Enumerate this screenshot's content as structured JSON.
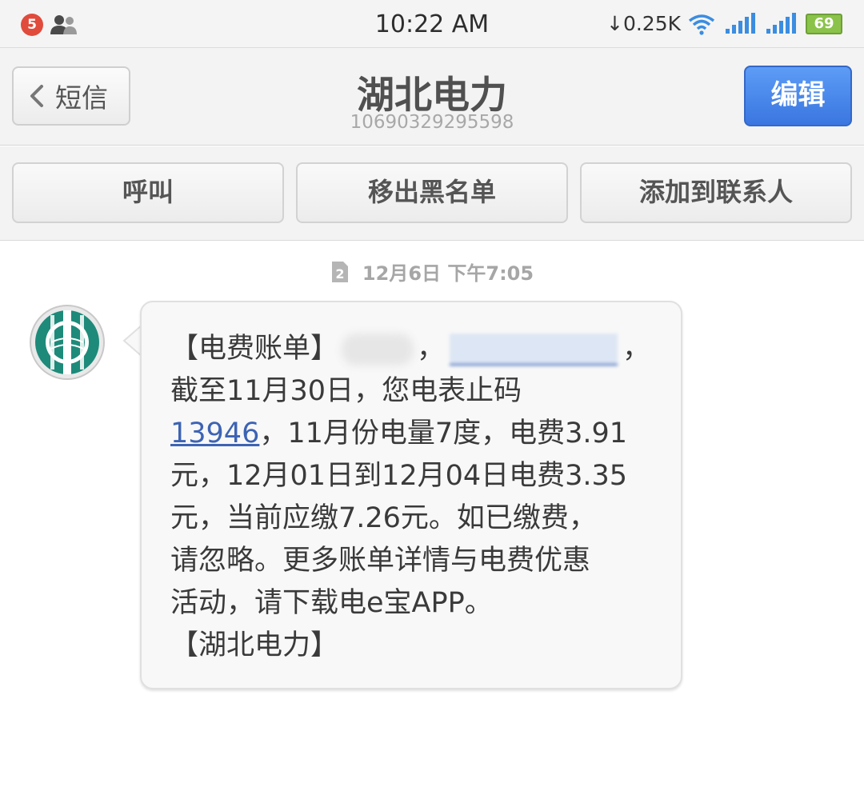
{
  "status_bar": {
    "notification_count": "5",
    "time": "10:22 AM",
    "net_speed": "0.25K",
    "battery": "69",
    "icons": [
      "people-icon",
      "download-arrow-icon",
      "wifi-icon",
      "signal-1-icon",
      "signal-2-icon",
      "battery-icon"
    ]
  },
  "header": {
    "back_label": "短信",
    "title": "湖北电力",
    "subtitle": "10690329295598",
    "edit_label": "编辑"
  },
  "actions": {
    "call": "呼叫",
    "remove_blacklist": "移出黑名单",
    "add_contact": "添加到联系人"
  },
  "conversation": {
    "timestamp": "12月6日 下午7:05",
    "sim_slot": "2",
    "message": {
      "line1_prefix": "【电费账单】",
      "line1_sep": "，",
      "line1_end": "，",
      "line2": "截至11月30日，您电表止码",
      "meter_reading": "13946",
      "line3_rest": "，11月份电量7度，电费3.91",
      "line4": "元，12月01日到12月04日电费3.35",
      "line5": "元，当前应缴7.26元。如已缴费，",
      "line6": "请忽略。更多账单详情与电费优惠",
      "line7": "活动，请下载电e宝APP。",
      "line8": "【湖北电力】"
    }
  },
  "colors": {
    "accent_blue": "#3a76e0",
    "badge_red": "#e04b3c",
    "link_blue": "#3d63b3",
    "avatar_teal": "#1e8a7a"
  }
}
